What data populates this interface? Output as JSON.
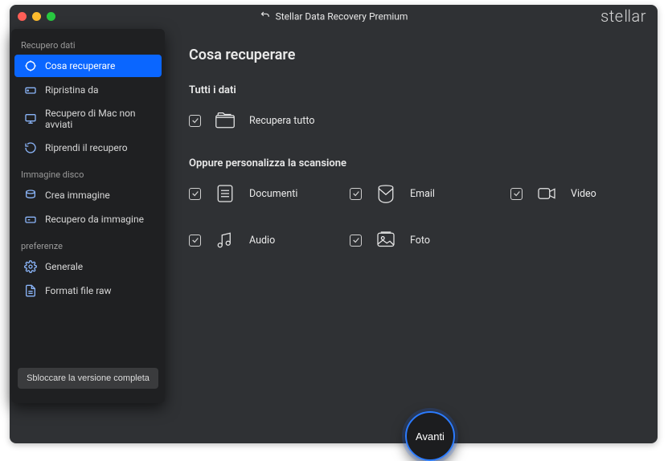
{
  "title": "Stellar Data Recovery Premium",
  "brand": "stellar",
  "sidebar": {
    "groups": [
      {
        "label": "Recupero dati",
        "items": [
          {
            "label": "Cosa recuperare",
            "active": true
          },
          {
            "label": "Ripristina da",
            "active": false
          },
          {
            "label": "Recupero di Mac non avviati",
            "active": false
          },
          {
            "label": "Riprendi il recupero",
            "active": false
          }
        ]
      },
      {
        "label": "Immagine disco",
        "items": [
          {
            "label": "Crea immagine",
            "active": false
          },
          {
            "label": "Recupero da immagine",
            "active": false
          }
        ]
      },
      {
        "label": "preferenze",
        "items": [
          {
            "label": "Generale",
            "active": false
          },
          {
            "label": "Formati file raw",
            "active": false
          }
        ]
      }
    ],
    "unlock": "Sbloccare la versione completa"
  },
  "main": {
    "heading": "Cosa recuperare",
    "all_data_title": "Tutti i dati",
    "recover_all": "Recupera tutto",
    "customize_title": "Oppure personalizza la scansione",
    "options": {
      "documents": "Documenti",
      "email": "Email",
      "video": "Video",
      "audio": "Audio",
      "photo": "Foto"
    },
    "next": "Avanti"
  }
}
